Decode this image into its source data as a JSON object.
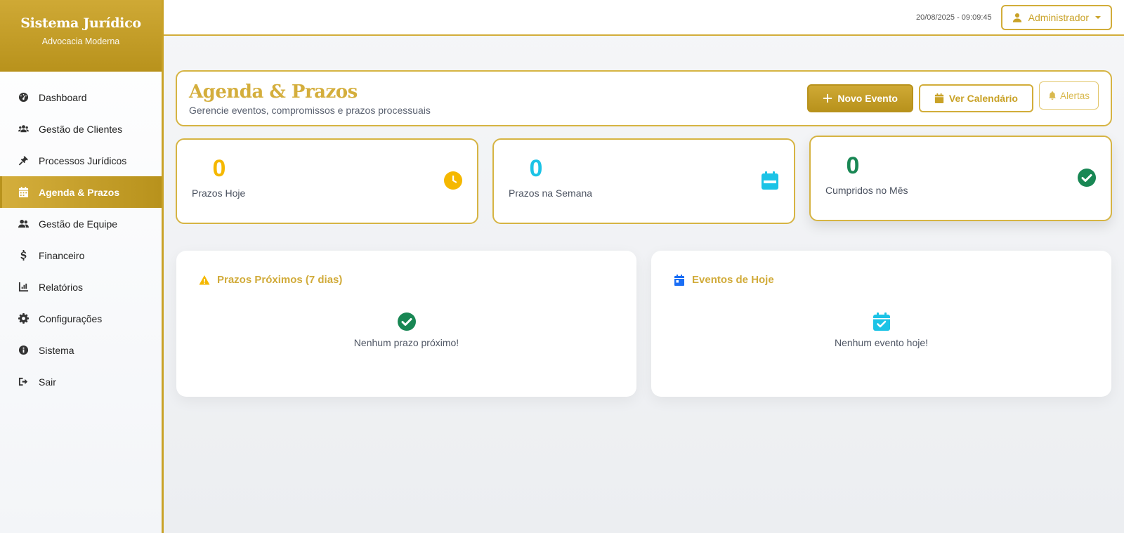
{
  "brand": {
    "title": "Sistema Jurídico",
    "subtitle": "Advocacia Moderna"
  },
  "sidebar": {
    "items": [
      {
        "label": "Dashboard",
        "icon": "gauge-icon"
      },
      {
        "label": "Gestão de Clientes",
        "icon": "users-icon"
      },
      {
        "label": "Processos Jurídicos",
        "icon": "gavel-icon"
      },
      {
        "label": "Agenda & Prazos",
        "icon": "calendar-icon",
        "active": true
      },
      {
        "label": "Gestão de Equipe",
        "icon": "team-icon"
      },
      {
        "label": "Financeiro",
        "icon": "dollar-icon"
      },
      {
        "label": "Relatórios",
        "icon": "chart-icon"
      },
      {
        "label": "Configurações",
        "icon": "gear-icon"
      },
      {
        "label": "Sistema",
        "icon": "info-icon"
      },
      {
        "label": "Sair",
        "icon": "logout-icon"
      }
    ]
  },
  "topbar": {
    "datetime": "20/08/2025 - 09:09:45",
    "user_label": "Administrador"
  },
  "header": {
    "title": "Agenda & Prazos",
    "subtitle": "Gerencie eventos, compromissos e prazos processuais",
    "new_event_label": "Novo Evento",
    "calendar_label": "Ver Calendário",
    "alerts_label": "Alertas"
  },
  "stats": [
    {
      "value": "0",
      "label": "Prazos Hoje",
      "color": "#f5b800",
      "icon": "clock-icon"
    },
    {
      "value": "0",
      "label": "Prazos na Semana",
      "color": "#1cc3e6",
      "icon": "calendar-week-icon"
    },
    {
      "value": "0",
      "label": "Cumpridos no Mês",
      "color": "#198754",
      "icon": "check-circle-icon"
    }
  ],
  "panels": {
    "deadlines": {
      "title": "Prazos Próximos (7 dias)",
      "empty": "Nenhum prazo próximo!"
    },
    "events": {
      "title": "Eventos de Hoje",
      "empty": "Nenhum evento hoje!"
    }
  },
  "colors": {
    "accent": "#c9a227",
    "accent_light": "#d4ae3c",
    "warning": "#f5b800",
    "info": "#1cc3e6",
    "success": "#198754",
    "primary": "#1a6ef5"
  }
}
